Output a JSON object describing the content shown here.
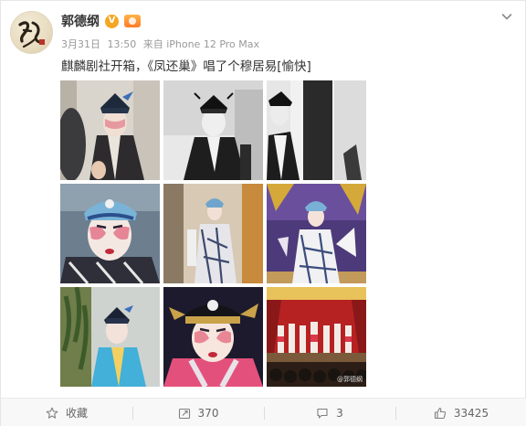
{
  "post": {
    "username": "郭德纲",
    "verified_badge": "V",
    "date": "3月31日",
    "time": "13:50",
    "source": "来自 iPhone 12 Pro Max",
    "text": "麒麟剧社开箱，《凤还巢》唱了个穆居易[愉快]",
    "watermark": "@郭德纲"
  },
  "photos": [
    {
      "subject": "dressing-room-actor-with-assistant"
    },
    {
      "subject": "actor-in-black-costume-bw"
    },
    {
      "subject": "actor-side-profile-bw"
    },
    {
      "subject": "closeup-pink-makeup-blue-hat"
    },
    {
      "subject": "full-costume-standing"
    },
    {
      "subject": "on-stage-performance"
    },
    {
      "subject": "actor-blue-robe-curtain"
    },
    {
      "subject": "closeup-black-hat-pink-collar"
    },
    {
      "subject": "stage-ensemble-red-backdrop"
    }
  ],
  "actions": {
    "collect_label": "收藏",
    "repost_count": "370",
    "comment_count": "3",
    "like_count": "33425"
  },
  "icons": {
    "avatar": "calligraphy-avatar",
    "more": "chevron-down-icon",
    "collect": "star-icon",
    "repost": "repost-icon",
    "comment": "comment-icon",
    "like": "thumbs-up-icon"
  },
  "colors": {
    "verified": "#f5a623",
    "meta_text": "#999999",
    "action_bar": "#f8f8f8"
  }
}
